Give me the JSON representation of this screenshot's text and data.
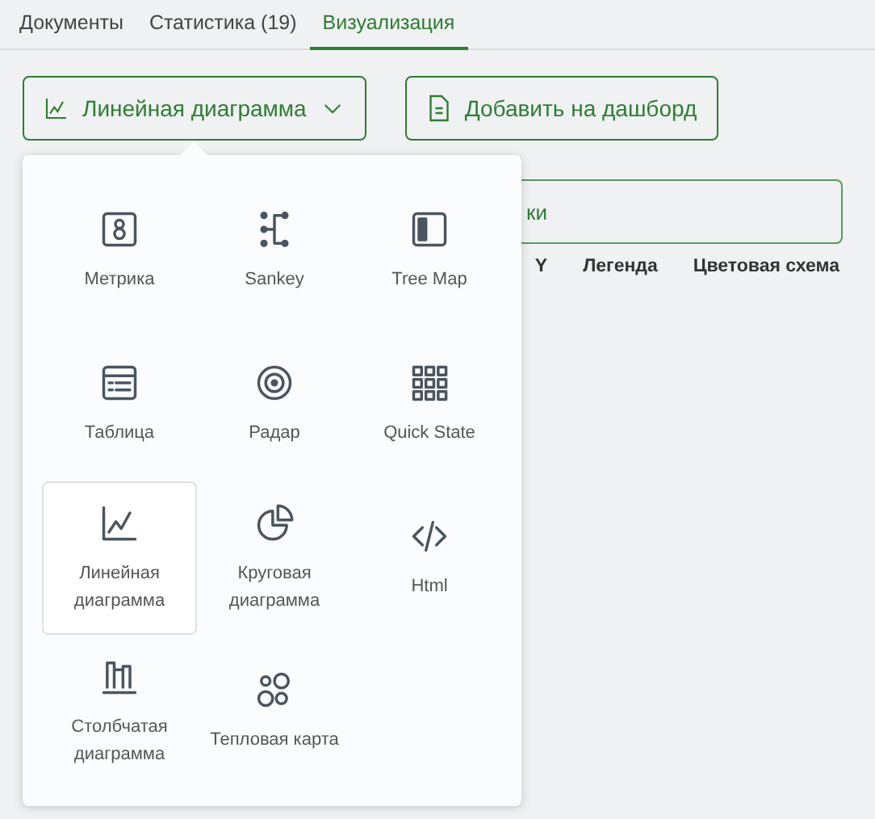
{
  "tabs": [
    {
      "label": "Документы",
      "selected": false
    },
    {
      "label": "Статистика (19)",
      "selected": false
    },
    {
      "label": "Визуализация",
      "selected": true
    }
  ],
  "chart_select": {
    "label": "Линейная диаграмма",
    "expanded": true
  },
  "add_button": {
    "label": "Добавить на дашборд"
  },
  "hidden_field": {
    "value": "ки"
  },
  "settings_labels": [
    "Y",
    "Легенда",
    "Цветовая схема"
  ],
  "chart_types": [
    {
      "kind": "metric",
      "label": "Метрика",
      "selected": false
    },
    {
      "kind": "sankey",
      "label": "Sankey",
      "selected": false
    },
    {
      "kind": "treemap",
      "label": "Tree Map",
      "selected": false
    },
    {
      "kind": "table",
      "label": "Таблица",
      "selected": false
    },
    {
      "kind": "radar",
      "label": "Радар",
      "selected": false
    },
    {
      "kind": "grid",
      "label": "Quick State",
      "selected": false
    },
    {
      "kind": "line",
      "label": "Линейная диаграмма",
      "selected": true
    },
    {
      "kind": "pie",
      "label": "Круговая диаграмма",
      "selected": false
    },
    {
      "kind": "code",
      "label": "Html",
      "selected": false
    },
    {
      "kind": "bar",
      "label": "Столбчатая диаграмма",
      "selected": false
    },
    {
      "kind": "bubbles",
      "label": "Тепловая карта",
      "selected": false
    }
  ]
}
